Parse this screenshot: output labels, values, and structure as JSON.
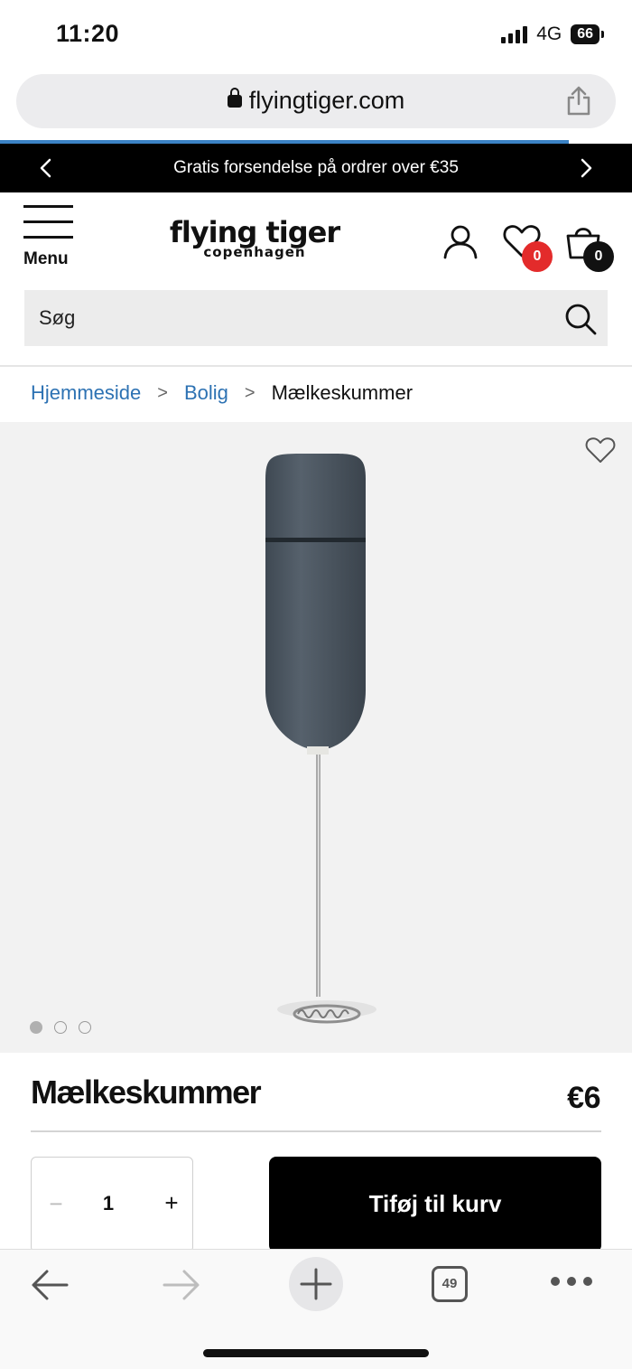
{
  "status": {
    "time": "11:20",
    "network": "4G",
    "battery": "66"
  },
  "browser": {
    "url": "flyingtiger.com",
    "tab_count": "49"
  },
  "promo": {
    "text": "Gratis forsendelse på ordrer over €35"
  },
  "header": {
    "menu_label": "Menu",
    "logo_main": "flying tiger",
    "logo_sub": "copenhagen",
    "wishlist_count": "0",
    "cart_count": "0"
  },
  "search": {
    "placeholder": "Søg"
  },
  "breadcrumb": {
    "items": [
      "Hjemmeside",
      "Bolig"
    ],
    "current": "Mælkeskummer"
  },
  "product": {
    "title": "Mælkeskummer",
    "price": "€6",
    "quantity": "1",
    "qty_minus": "−",
    "qty_plus": "+",
    "add_to_cart": "Tiføj til kurv",
    "image_count": 3,
    "active_image_index": 0,
    "handle_color": "#4a5560"
  },
  "colors": {
    "accent_link": "#2d72b3",
    "badge_red": "#e32b2b",
    "progress": "#3b82c4"
  }
}
